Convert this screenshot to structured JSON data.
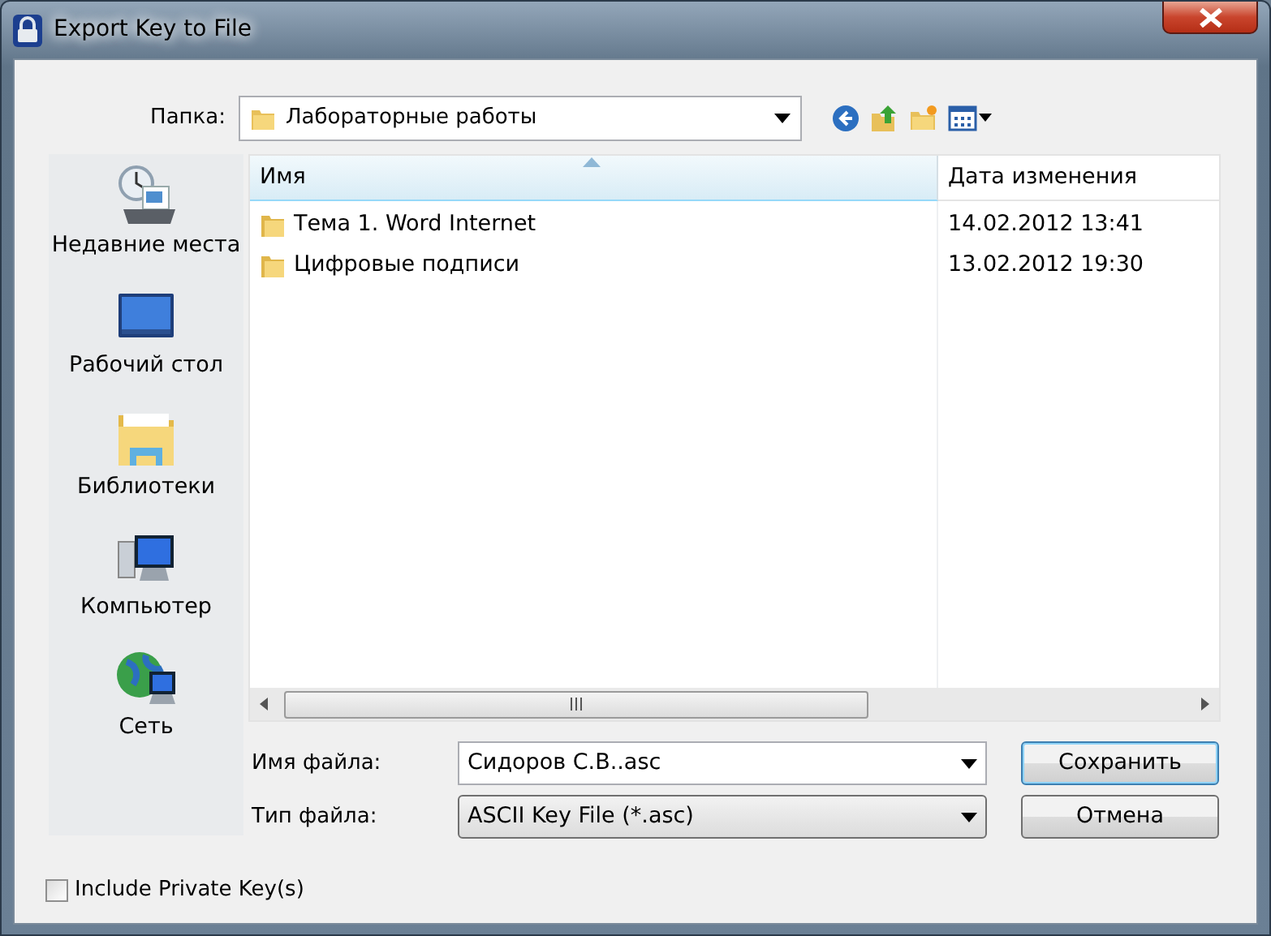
{
  "window": {
    "title": "Export Key to File"
  },
  "folder": {
    "label": "Папка:",
    "value": "Лабораторные работы"
  },
  "places": [
    {
      "label": "Недавние места",
      "kind": "recent"
    },
    {
      "label": "Рабочий стол",
      "kind": "desktop"
    },
    {
      "label": "Библиотеки",
      "kind": "libraries"
    },
    {
      "label": "Компьютер",
      "kind": "computer"
    },
    {
      "label": "Сеть",
      "kind": "network"
    }
  ],
  "columns": [
    {
      "label": "Имя",
      "sorted": true
    },
    {
      "label": "Дата изменения",
      "sorted": false
    }
  ],
  "files": [
    {
      "name": "Тема 1. Word Internet",
      "modified": "14.02.2012 13:41"
    },
    {
      "name": "Цифровые подписи",
      "modified": "13.02.2012 19:30"
    }
  ],
  "file_name": {
    "label": "Имя файла:",
    "value": "Сидоров С.В..asc"
  },
  "file_type": {
    "label": "Тип файла:",
    "value": "ASCII Key File (*.asc)"
  },
  "buttons": [
    {
      "label": "Сохранить",
      "default": true
    },
    {
      "label": "Отмена",
      "default": false
    }
  ],
  "include_private": {
    "label": "Include Private Key(s)",
    "checked": false
  }
}
